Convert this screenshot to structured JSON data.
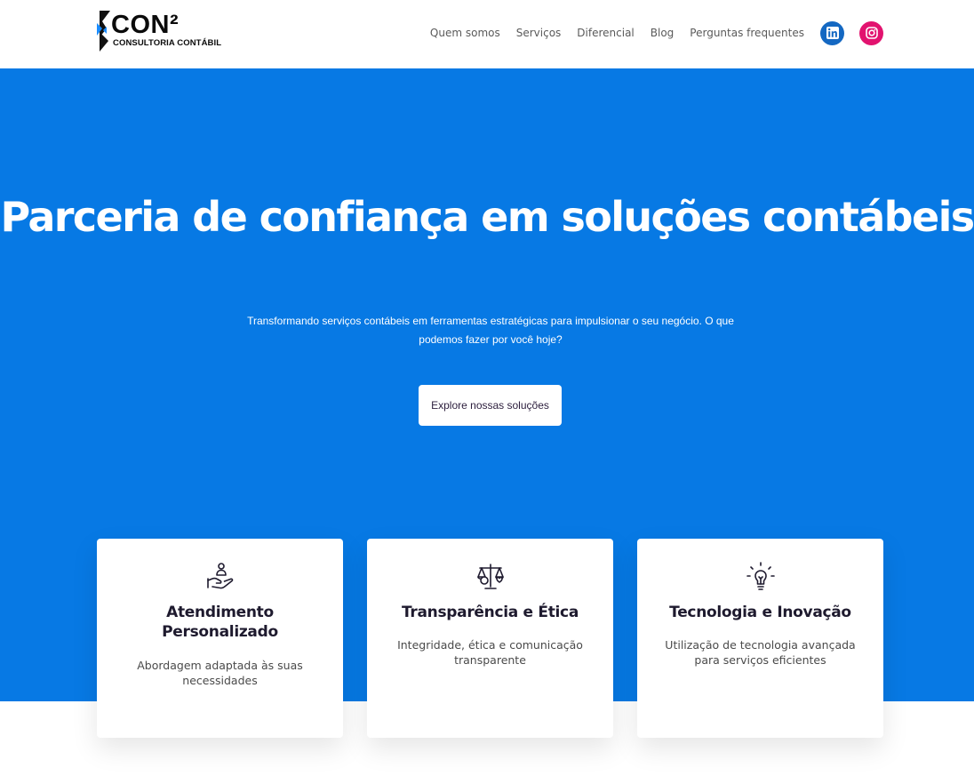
{
  "brand": {
    "name": "CON²",
    "tagline": "CONSULTORIA CONTÁBIL",
    "colors": {
      "mark_dark": "#111111",
      "mark_blue": "#1a8cff"
    }
  },
  "nav": {
    "items": [
      {
        "label": "Quem somos"
      },
      {
        "label": "Serviços"
      },
      {
        "label": "Diferencial"
      },
      {
        "label": "Blog"
      },
      {
        "label": "Perguntas frequentes"
      }
    ],
    "social": [
      {
        "icon": "linkedin-icon",
        "color": "#1468c2"
      },
      {
        "icon": "instagram-icon",
        "color": "#e2136f"
      }
    ]
  },
  "hero": {
    "background": "#0779e4",
    "title": "Parceria de confiança em soluções contábeis",
    "subtitle": "Transformando serviços contábeis em ferramentas estratégicas para impulsionar o seu negócio. O que podemos fazer por você hoje?",
    "cta_label": "Explore nossas soluções"
  },
  "features": [
    {
      "icon": "hand-person-icon",
      "title": "Atendimento Personalizado",
      "description": "Abordagem adaptada às suas necessidades"
    },
    {
      "icon": "scale-icon",
      "title": "Transparência e Ética",
      "description": "Integridade, ética e comunicação transparente"
    },
    {
      "icon": "lightbulb-icon",
      "title": "Tecnologia e Inovação",
      "description": "Utilização de tecnologia avançada para serviços eficientes"
    }
  ]
}
